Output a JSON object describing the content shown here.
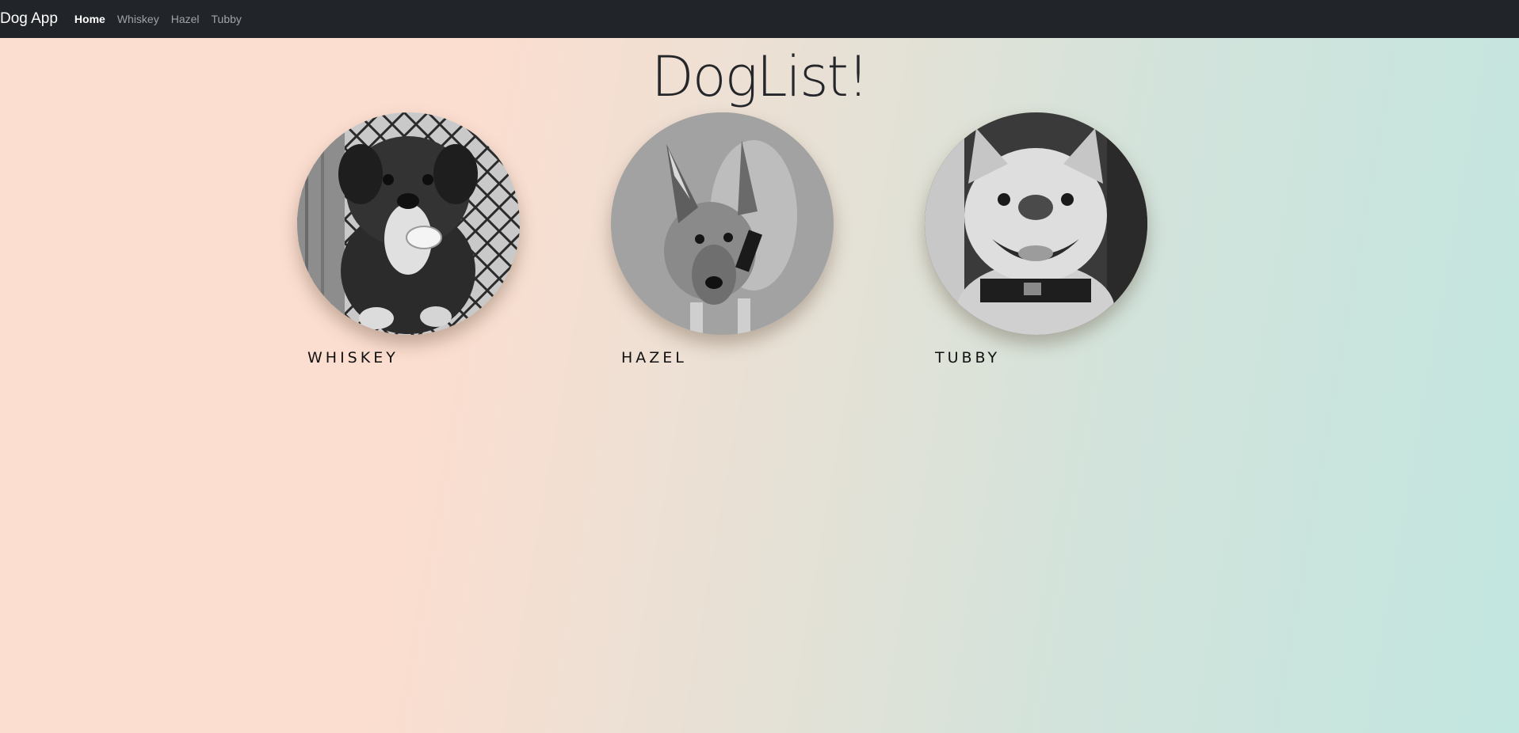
{
  "nav": {
    "brand": "Dog App",
    "links": [
      {
        "label": "Home",
        "active": true
      },
      {
        "label": "Whiskey",
        "active": false
      },
      {
        "label": "Hazel",
        "active": false
      },
      {
        "label": "Tubby",
        "active": false
      }
    ]
  },
  "page": {
    "title": "DogList!"
  },
  "dogs": [
    {
      "name": "WHISKEY",
      "image": "whiskey-photo"
    },
    {
      "name": "HAZEL",
      "image": "hazel-photo"
    },
    {
      "name": "TUBBY",
      "image": "tubby-photo"
    }
  ],
  "colors": {
    "navbar": "#212429",
    "gradient_start": "#fcded0",
    "gradient_end": "#c2e6e0"
  }
}
